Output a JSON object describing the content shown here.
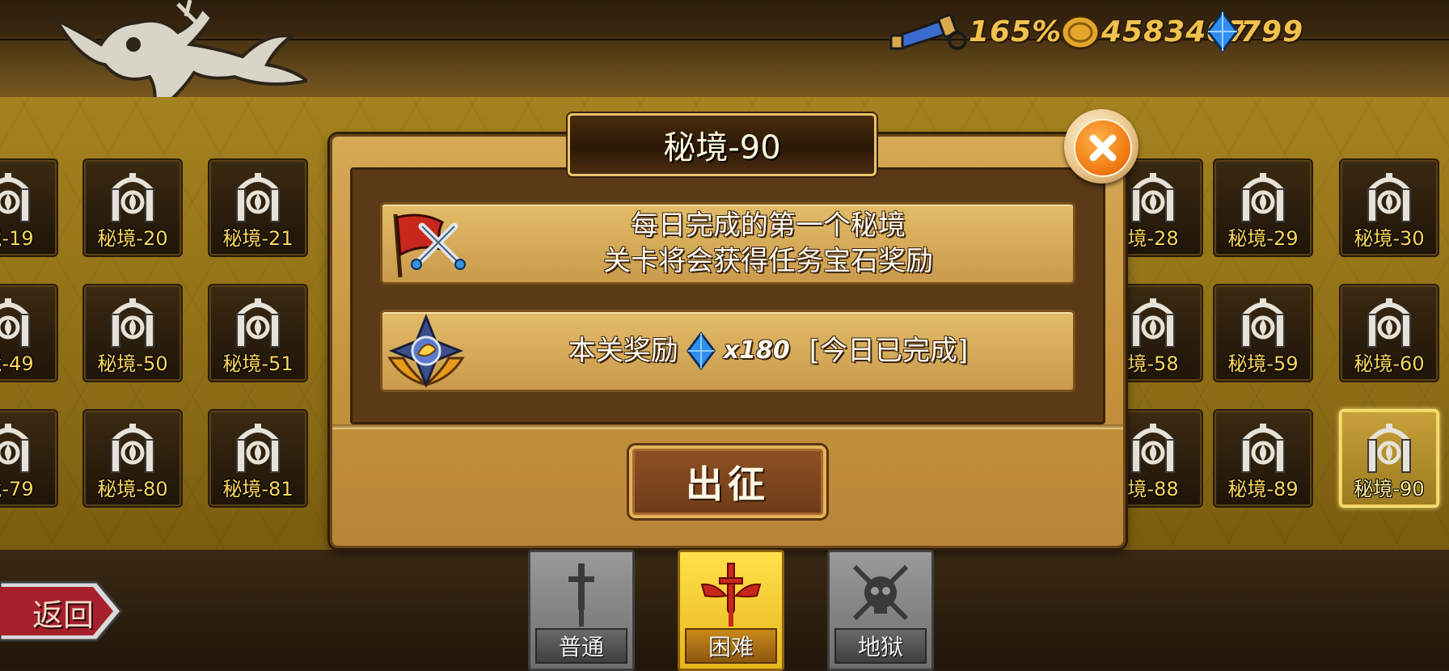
{
  "resources": {
    "telescope_value": "165%",
    "gold_value": "4583407",
    "gem_value": "799"
  },
  "stages": [
    {
      "label": "境-19"
    },
    {
      "label": "秘境-20"
    },
    {
      "label": "秘境-21"
    },
    {
      "label": "境-28"
    },
    {
      "label": "秘境-29"
    },
    {
      "label": "秘境-30"
    },
    {
      "label": "境-49"
    },
    {
      "label": "秘境-50"
    },
    {
      "label": "秘境-51"
    },
    {
      "label": "境-58"
    },
    {
      "label": "秘境-59"
    },
    {
      "label": "秘境-60"
    },
    {
      "label": "境-79"
    },
    {
      "label": "秘境-80"
    },
    {
      "label": "秘境-81"
    },
    {
      "label": "境-88"
    },
    {
      "label": "秘境-89"
    },
    {
      "label": "秘境-90"
    }
  ],
  "selected_stage": "秘境-90",
  "modal": {
    "title": "秘境-90",
    "info_line1": "每日完成的第一个秘境",
    "info_line2": "关卡将会获得任务宝石奖励",
    "reward_label": "本关奖励",
    "reward_qty": "x180",
    "reward_status": "[今日已完成]",
    "go_button": "出征"
  },
  "back_button": "返回",
  "difficulty_tabs": [
    {
      "label": "普通",
      "selected": false
    },
    {
      "label": "困难",
      "selected": true
    },
    {
      "label": "地狱",
      "selected": false
    }
  ],
  "colors": {
    "accent_gold": "#f1c24d",
    "tile_label": "#ffd85c",
    "gem_blue": "#2f8ef0",
    "close_orange": "#f07a12"
  },
  "icons": [
    "telescope-icon",
    "gold-coin-icon",
    "blue-gem-icon",
    "dragon-emblem-icon",
    "portal-gate-icon",
    "close-icon",
    "battle-flag-icon",
    "reward-medal-icon",
    "sword-icon",
    "winged-sword-icon",
    "skull-swords-icon"
  ]
}
